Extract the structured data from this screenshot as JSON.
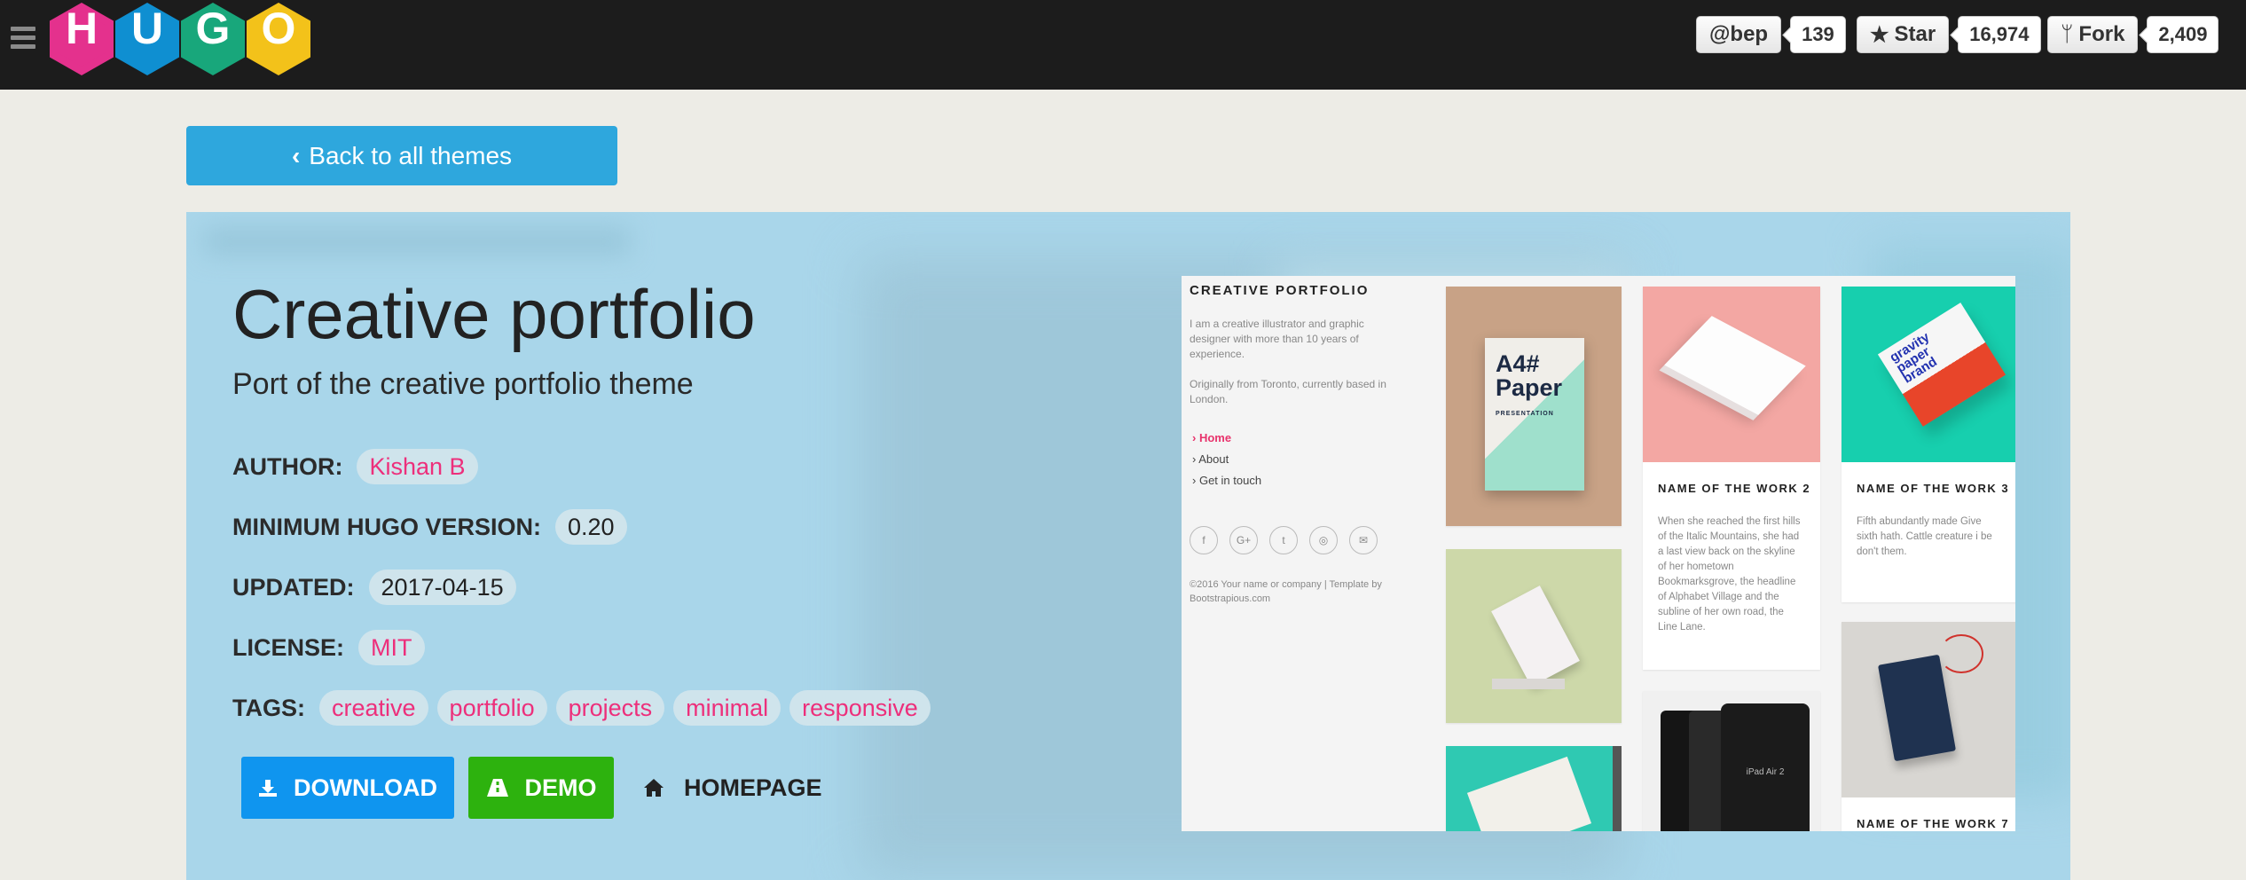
{
  "topbar": {
    "logo_letters": [
      "H",
      "U",
      "G",
      "O"
    ],
    "logo_colors": [
      "#e4318d",
      "#0f8fd1",
      "#18a77b",
      "#f3c21a"
    ],
    "github": {
      "user_label": "@bep",
      "user_count": "139",
      "star_label": "Star",
      "star_count": "16,974",
      "fork_label": "Fork",
      "fork_count": "2,409"
    }
  },
  "back_button": {
    "label": "Back to all themes"
  },
  "theme": {
    "title": "Creative portfolio",
    "subtitle": "Port of the creative portfolio theme",
    "author_label": "AUTHOR:",
    "author": "Kishan B",
    "min_version_label": "MINIMUM HUGO VERSION:",
    "min_version": "0.20",
    "updated_label": "UPDATED:",
    "updated": "2017-04-15",
    "license_label": "LICENSE:",
    "license": "MIT",
    "tags_label": "TAGS:",
    "tags": [
      "creative",
      "portfolio",
      "projects",
      "minimal",
      "responsive"
    ]
  },
  "actions": {
    "download": "DOWNLOAD",
    "demo": "DEMO",
    "homepage": "HOMEPAGE"
  },
  "colors": {
    "accent": "#2ea7dd",
    "tag_pink": "#ed2f7b",
    "download_blue": "#0f95ef",
    "demo_green": "#2db20e",
    "hero_bg": "#a9d6ea"
  },
  "preview": {
    "brand": "CREATIVE PORTFOLIO",
    "desc1": "I am a creative illustrator and graphic designer with more than 10 years of experience.",
    "desc2": "Originally from Toronto, currently based in London.",
    "nav": [
      "Home",
      "About",
      "Get in touch"
    ],
    "social": [
      "f",
      "G+",
      "t",
      "◎",
      "✉"
    ],
    "copyright": "©2016 Your name or company | Template by Bootstrapious.com",
    "paper_text": "A4# Paper",
    "paper_sub": "PRESENTATION",
    "card2_name": "NAME OF THE WORK 2",
    "card2_text": "When she reached the first hills of the Italic Mountains, she had a last view back on the skyline of her hometown Bookmarksgrove, the headline of Alphabet Village and the subline of her own road, the Line Lane.",
    "card3_name": "NAME OF THE WORK 3",
    "card3_text": "Fifth abundantly made Give sixth hath. Cattle creature i be don't them.",
    "card7_name": "NAME OF THE WORK 7",
    "gravity_text": "gravity paper brand",
    "ipad_text": "iPad Air 2"
  }
}
